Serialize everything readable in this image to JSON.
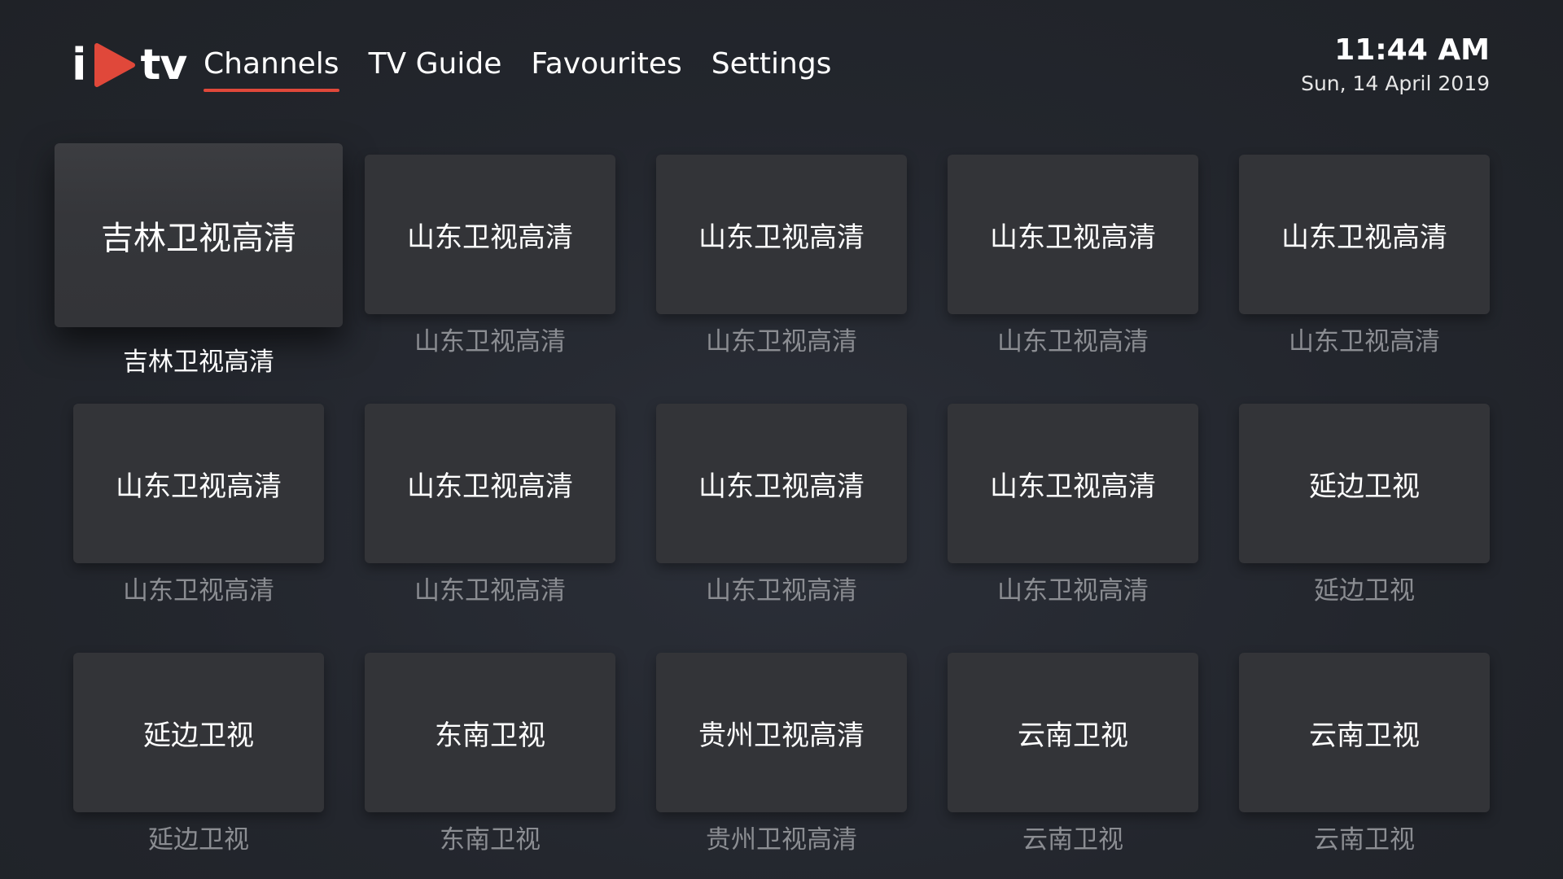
{
  "app": {
    "logo_text_left": "i",
    "logo_text_right": "tv",
    "accent_color": "#e0483a"
  },
  "nav": {
    "items": [
      {
        "label": "Channels",
        "active": true
      },
      {
        "label": "TV Guide",
        "active": false
      },
      {
        "label": "Favourites",
        "active": false
      },
      {
        "label": "Settings",
        "active": false
      }
    ]
  },
  "clock": {
    "time": "11:44 AM",
    "date": "Sun, 14 April 2019"
  },
  "channels": [
    {
      "title": "吉林卫视高清",
      "caption": "吉林卫视高清",
      "focused": true
    },
    {
      "title": "山东卫视高清",
      "caption": "山东卫视高清",
      "focused": false
    },
    {
      "title": "山东卫视高清",
      "caption": "山东卫视高清",
      "focused": false
    },
    {
      "title": "山东卫视高清",
      "caption": "山东卫视高清",
      "focused": false
    },
    {
      "title": "山东卫视高清",
      "caption": "山东卫视高清",
      "focused": false
    },
    {
      "title": "山东卫视高清",
      "caption": "山东卫视高清",
      "focused": false
    },
    {
      "title": "山东卫视高清",
      "caption": "山东卫视高清",
      "focused": false
    },
    {
      "title": "山东卫视高清",
      "caption": "山东卫视高清",
      "focused": false
    },
    {
      "title": "山东卫视高清",
      "caption": "山东卫视高清",
      "focused": false
    },
    {
      "title": "延边卫视",
      "caption": "延边卫视",
      "focused": false
    },
    {
      "title": "延边卫视",
      "caption": "延边卫视",
      "focused": false
    },
    {
      "title": "东南卫视",
      "caption": "东南卫视",
      "focused": false
    },
    {
      "title": "贵州卫视高清",
      "caption": "贵州卫视高清",
      "focused": false
    },
    {
      "title": "云南卫视",
      "caption": "云南卫视",
      "focused": false
    },
    {
      "title": "云南卫视",
      "caption": "云南卫视",
      "focused": false
    }
  ]
}
